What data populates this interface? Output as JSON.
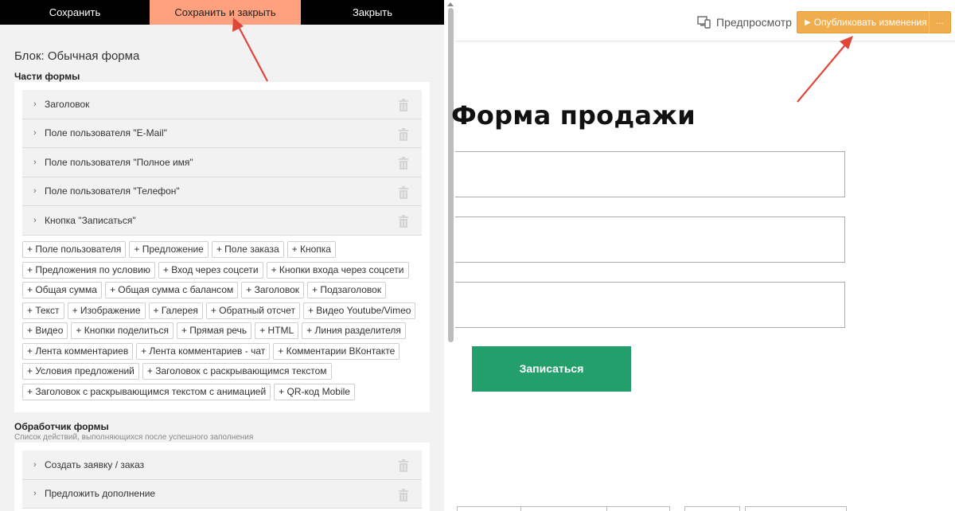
{
  "editor": {
    "tabs": [
      "Сохранить",
      "Сохранить и закрыть",
      "Закрыть"
    ],
    "block_title": "Блок: Обычная форма",
    "parts_title": "Части формы",
    "parts": [
      "Заголовок",
      "Поле пользователя \"E-Mail\"",
      "Поле пользователя \"Полное имя\"",
      "Поле пользователя \"Телефон\"",
      "Кнопка \"Записаться\""
    ],
    "add_items": [
      "+ Поле пользователя",
      "+ Предложение",
      "+ Поле заказа",
      "+ Кнопка",
      "+ Предложения по условию",
      "+ Вход через соцсети",
      "+ Кнопки входа через соцсети",
      "+ Общая сумма",
      "+ Общая сумма с балансом",
      "+ Заголовок",
      "+ Подзаголовок",
      "+ Текст",
      "+ Изображение",
      "+ Галерея",
      "+ Обратный отсчет",
      "+ Видео Youtube/Vimeo",
      "+ Видео",
      "+ Кнопки поделиться",
      "+ Прямая речь",
      "+ HTML",
      "+ Линия разделителя",
      "+ Лента комментариев",
      "+ Лента комментариев - чат",
      "+ Комментарии ВКонтакте",
      "+ Условия предложений",
      "+ Заголовок с раскрывающимся текстом",
      "+ Заголовок с раскрывающимся текстом с анимацией",
      "+ QR-код Mobile"
    ],
    "handler_title": "Обработчик формы",
    "handler_subtitle": "Список действий, выполняющихся после успешного заполнения",
    "handlers": [
      "Создать заявку / заказ",
      "Предложить дополнение"
    ]
  },
  "topbar": {
    "preview_label": "Предпросмотр",
    "publish_label": "Опубликовать изменения",
    "more_label": "..."
  },
  "preview": {
    "heading": "Форма продажи",
    "button_label": "Записаться"
  },
  "colors": {
    "active_tab": "#ffa07f",
    "publish": "#f0ad4e",
    "submit": "#229f6b",
    "annotation_arrow": "#e0453a"
  },
  "icons": [
    "trash-icon",
    "chevron-right-icon",
    "devices-icon",
    "play-icon"
  ]
}
